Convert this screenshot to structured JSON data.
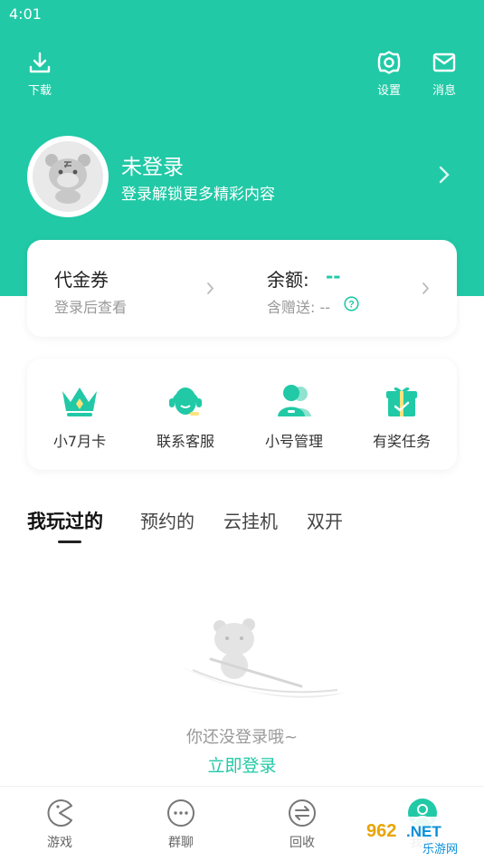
{
  "status_bar": {
    "time": "4:01"
  },
  "top_actions": {
    "download": "下载",
    "settings": "设置",
    "messages": "消息"
  },
  "user": {
    "name": "未登录",
    "subtitle": "登录解锁更多精彩内容"
  },
  "wallet": {
    "voucher_title": "代金券",
    "voucher_sub": "登录后查看",
    "balance_title": "余额:",
    "balance_value": "--",
    "gift_sub": "含赠送: --"
  },
  "features": [
    {
      "label": "小7月卡",
      "icon": "crown-icon"
    },
    {
      "label": "联系客服",
      "icon": "headset-icon"
    },
    {
      "label": "小号管理",
      "icon": "users-icon"
    },
    {
      "label": "有奖任务",
      "icon": "gift-icon"
    }
  ],
  "tabs": [
    "我玩过的",
    "预约的",
    "云挂机",
    "双开"
  ],
  "empty_state": {
    "text": "你还没登录哦~",
    "login_link": "立即登录"
  },
  "bottom_nav": [
    {
      "label": "游戏",
      "icon": "pacman-icon"
    },
    {
      "label": "群聊",
      "icon": "chat-bubble-icon"
    },
    {
      "label": "回收",
      "icon": "recycle-icon"
    },
    {
      "label": "我的",
      "icon": "profile-icon"
    }
  ],
  "colors": {
    "accent": "#21c9a6"
  },
  "watermark": {
    "text": "962.NET",
    "sub": "乐游网"
  }
}
